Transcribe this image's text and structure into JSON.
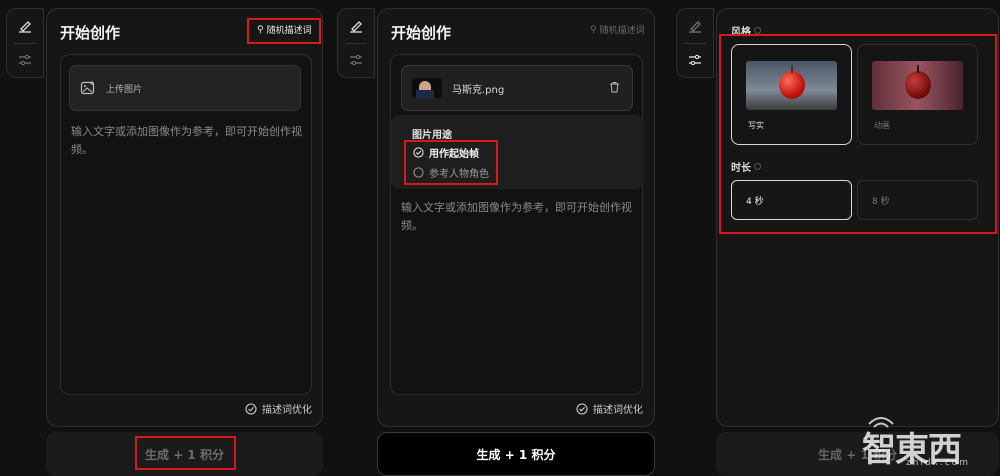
{
  "panel1": {
    "title": "开始创作",
    "random_prompt": "随机描述词",
    "upload_label": "上传图片",
    "prompt_placeholder": "输入文字或添加图像作为参考，即可开始创作视频。",
    "optimize_label": "描述词优化",
    "generate_label": "生成 + 1 积分"
  },
  "panel2": {
    "title": "开始创作",
    "random_prompt": "随机描述词",
    "file_name": "马斯克.png",
    "usage_title": "图片用途",
    "usage_options": [
      "用作起始帧",
      "参考人物角色"
    ],
    "prompt_placeholder": "输入文字或添加图像作为参考，即可开始创作视频。",
    "optimize_label": "描述词优化",
    "generate_label": "生成 + 1 积分"
  },
  "panel3": {
    "style_label": "风格",
    "styles": [
      "写实",
      "动画"
    ],
    "duration_label": "时长",
    "durations": [
      "4 秒",
      "8 秒"
    ],
    "generate_label": "生成 + 1 积分"
  },
  "watermark": {
    "brand": "智東西",
    "domain": "zhidx.com"
  },
  "colors": {
    "highlight": "#d8181c",
    "panel": "#161616",
    "accent": "#ffffff"
  }
}
